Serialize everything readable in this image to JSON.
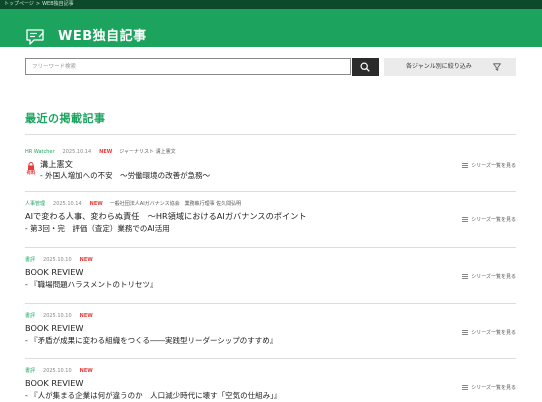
{
  "breadcrumb": {
    "home": "トップページ",
    "separator": ">",
    "current": "WEB独自記事"
  },
  "header": {
    "title": "WEB独自記事",
    "logo_icon": "web-article-icon"
  },
  "search": {
    "placeholder": "フリーワード検索",
    "button_icon": "search-icon"
  },
  "genre_filter": {
    "label": "各ジャンル別に絞り込み",
    "icon": "filter-icon"
  },
  "section": {
    "title": "最近の掲載記事"
  },
  "articles": [
    {
      "category": "HR Watcher",
      "date": "2025.10.14",
      "new_label": "NEW",
      "author": "ジャーナリスト 溝上憲文",
      "paid_label": "有料",
      "title_line1": "溝上憲文",
      "title_line2": "- 外国人増加への不安　～労働環境の改善が急務～",
      "series_label": "シリーズ一覧を見る"
    },
    {
      "category": "人事管理",
      "date": "2025.10.14",
      "new_label": "NEW",
      "author": "一般社団法人AIガバナンス協会　業務執行理事 佐久間弘明",
      "title_line1": "AIで変わる人事、変わらぬ責任　～HR領域におけるAIガバナンスのポイント",
      "title_line2": "- 第3回・完　評価（査定）業務でのAI活用",
      "series_label": "シリーズ一覧を見る"
    },
    {
      "category": "書評",
      "date": "2025.10.10",
      "new_label": "NEW",
      "title_line1": "BOOK REVIEW",
      "title_line2": "- 『職場問題ハラスメントのトリセツ』",
      "series_label": "シリーズ一覧を見る"
    },
    {
      "category": "書評",
      "date": "2025.10.10",
      "new_label": "NEW",
      "title_line1": "BOOK REVIEW",
      "title_line2": "- 『矛盾が成果に変わる組織をつくる――実践型リーダーシップのすすめ』",
      "series_label": "シリーズ一覧を見る"
    },
    {
      "category": "書評",
      "date": "2025.10.10",
      "new_label": "NEW",
      "title_line1": "BOOK REVIEW",
      "title_line2": "- 『人が集まる企業は何が違うのか　人口減少時代に壊す「空気の仕組み」』",
      "series_label": "シリーズ一覧を見る"
    }
  ],
  "colors": {
    "brand_green": "#1ca45f",
    "dark_green": "#0d4a2c",
    "new_red": "#e53c3c",
    "search_button": "#2b2b2b"
  }
}
